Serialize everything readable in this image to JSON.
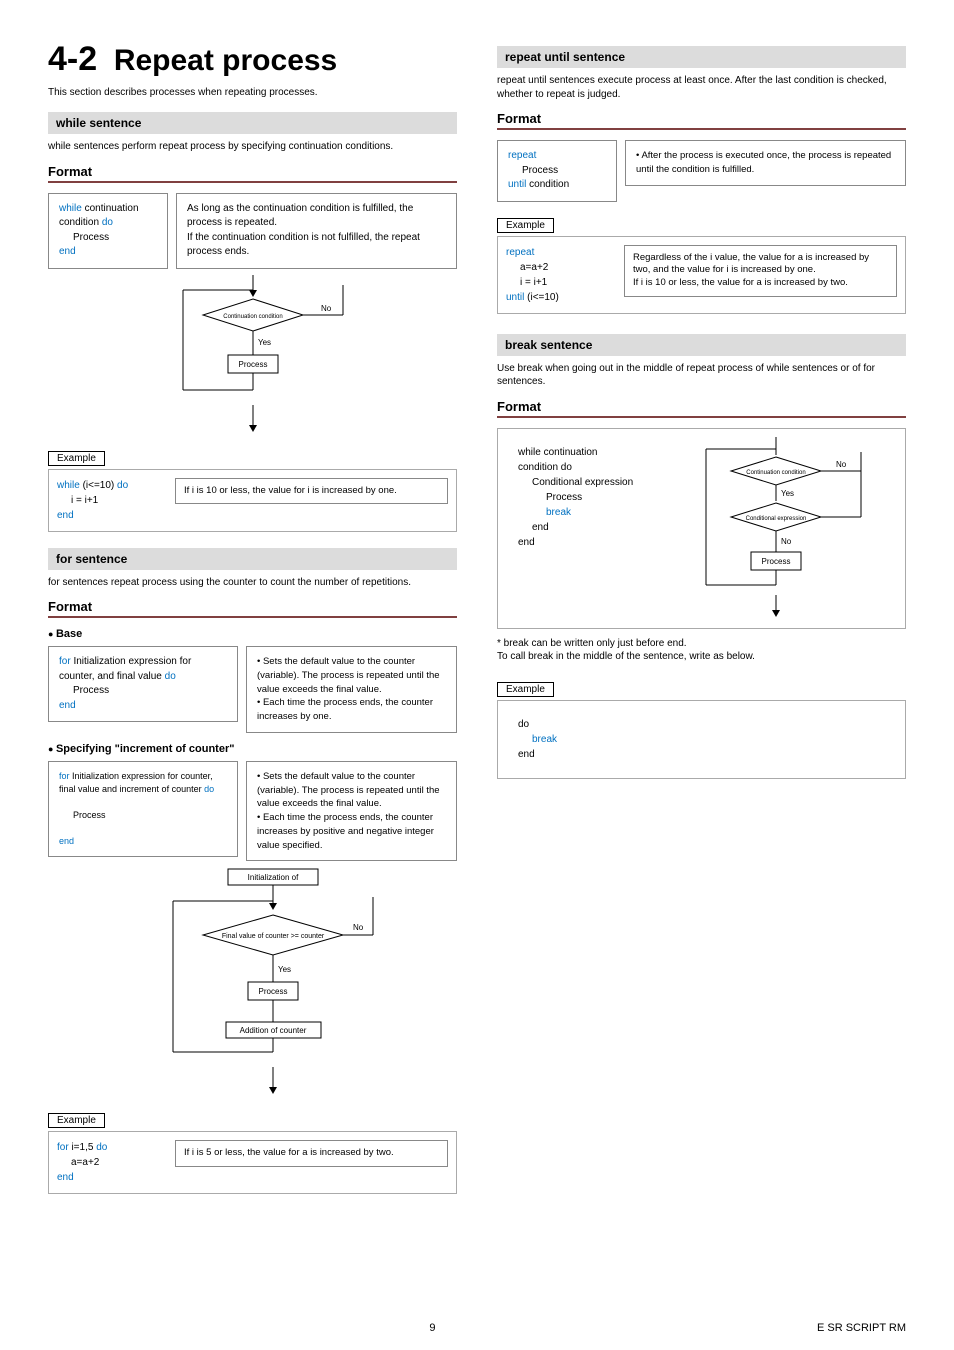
{
  "header": {
    "section_number": "4-2",
    "section_title": "Repeat process",
    "intro": "This section describes processes when repeating processes."
  },
  "while_section": {
    "header": "while sentence",
    "desc": "while sentences perform repeat process by specifying continuation conditions.",
    "format_label": "Format",
    "code": {
      "kw1": "while",
      "txt1": " continuation condition ",
      "kw2": "do",
      "process": "Process",
      "kw3": "end"
    },
    "desc_box": "As long as the continuation condition is fulfilled, the process is repeated.\nIf the continuation condition is not fulfilled, the repeat process ends.",
    "flow": {
      "cond": "Continuation condition",
      "yes": "Yes",
      "no": "No",
      "process": "Process"
    },
    "example_label": "Example",
    "example_code": {
      "kw1": "while",
      "cond": " (i<=10) ",
      "kw2": "do",
      "body": "i = i+1",
      "kw3": "end"
    },
    "example_note": "If i is 10 or less, the value for i is increased by one."
  },
  "for_section": {
    "header": "for sentence",
    "desc": "for sentences repeat process using the counter to count the number of repetitions.",
    "format_label": "Format",
    "base_label": "Base",
    "base_code": {
      "kw1": "for",
      "txt1": " Initialization expression for counter, and final value ",
      "kw2": "do",
      "process": "Process",
      "kw3": "end"
    },
    "base_desc": "• Sets the default value to the counter (variable). The process is repeated until the value exceeds the final value.\n• Each time the process ends, the counter increases by one.",
    "inc_label": "Specifying \"increment of counter\"",
    "inc_code": {
      "kw1": "for",
      "txt1": "  Initialization expression for counter, final value and increment of counter ",
      "kw2": "do",
      "process": "Process",
      "kw3": "end"
    },
    "inc_desc": "• Sets the default value to the counter (variable). The process is repeated until the value exceeds the final value.\n• Each time the process ends, the counter increases by positive and negative integer value specified.",
    "flow": {
      "init": "Initialization of",
      "cond": "Final value of counter >= counter",
      "yes": "Yes",
      "no": "No",
      "process": "Process",
      "add": "Addition of counter"
    },
    "example_label": "Example",
    "example_code": {
      "kw1": "for",
      "txt1": " i=1,5 ",
      "kw2": "do",
      "body": "a=a+2",
      "kw3": "end"
    },
    "example_note": "If i is 5 or less, the value for a is increased by two."
  },
  "repeat_section": {
    "header": "repeat until sentence",
    "desc": "repeat until sentences execute process at least once. After the last condition is checked, whether to repeat is judged.",
    "format_label": "Format",
    "code": {
      "kw1": "repeat",
      "process": "Process",
      "kw2": "until",
      "txt2": " condition"
    },
    "desc_box": "• After the process is executed once, the process is repeated until the condition is fulfilled.",
    "example_label": "Example",
    "example_code": {
      "kw1": "repeat",
      "body1": "a=a+2",
      "body2": "i = i+1",
      "kw2": "until",
      "cond": " (i<=10)"
    },
    "example_note": "Regardless of the i value, the value for a is increased by two, and the value for i is increased by one.\nIf i is 10 or less, the value for a is increased by two."
  },
  "break_section": {
    "header": "break sentence",
    "desc": "Use break when going out in the middle of repeat process of while sentences or of for sentences.",
    "format_label": "Format",
    "code": {
      "line1": "while continuation",
      "line2": "condition do",
      "line3": "Conditional expression",
      "line4": "Process",
      "kw_break": "break",
      "line5": "end",
      "line6": "end"
    },
    "flow": {
      "cond1": "Continuation condition",
      "cond2": "Conditional expression",
      "yes": "Yes",
      "no": "No",
      "process": "Process"
    },
    "footnote": "* break can be written only just before end.\n  To call break in the middle of the sentence, write as below.",
    "example_label": "Example",
    "example_code": {
      "line1": "do",
      "kw_break": "break",
      "line3": "end"
    }
  },
  "footer": {
    "page": "9",
    "doc": "E SR SCRIPT RM"
  }
}
